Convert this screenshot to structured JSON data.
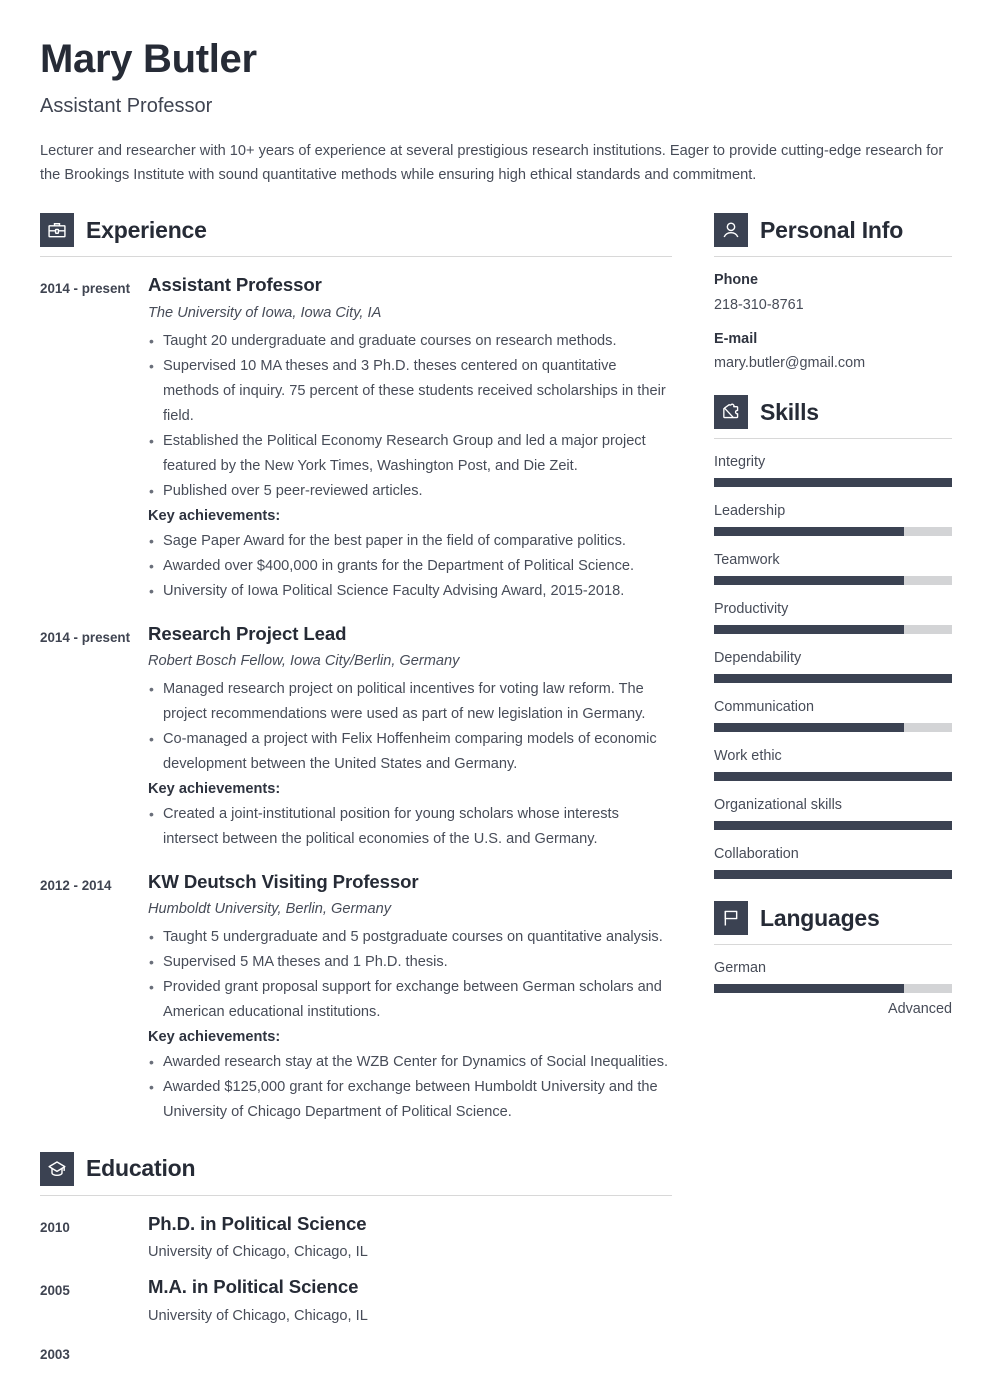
{
  "header": {
    "name": "Mary Butler",
    "job_title": "Assistant Professor",
    "summary": "Lecturer and researcher with 10+ years of experience at several prestigious research institutions. Eager to provide cutting-edge research for the Brookings Institute with sound quantitative methods while ensuring high ethical standards and commitment."
  },
  "colors": {
    "accent_dark": "#3b4252",
    "heading": "#262b36",
    "body_text": "#474c58",
    "bar_track": "#d3d4d6",
    "rule": "#d8d8d8"
  },
  "sections": {
    "experience": {
      "title": "Experience",
      "icon": "briefcase-icon",
      "entries": [
        {
          "date": "2014 - present",
          "title": "Assistant Professor",
          "subtitle": "The University of Iowa, Iowa City, IA",
          "bullets": [
            "Taught 20 undergraduate and graduate courses on research methods.",
            "Supervised 10 MA theses and 3 Ph.D. theses centered on quantitative methods of inquiry. 75 percent of these students received scholarships in their field.",
            "Established the Political Economy Research Group and led a major project featured by the New York Times, Washington Post, and Die Zeit.",
            "Published over 5 peer-reviewed articles."
          ],
          "achievements_label": "Key achievements:",
          "achievements": [
            "Sage Paper Award for the best paper in the field of comparative politics.",
            "Awarded over $400,000 in grants for the Department of Political Science.",
            "University of Iowa Political Science Faculty Advising Award, 2015-2018."
          ]
        },
        {
          "date": "2014 - present",
          "title": "Research Project Lead",
          "subtitle": "Robert Bosch Fellow, Iowa City/Berlin, Germany",
          "bullets": [
            "Managed research project on political incentives for voting law reform. The project recommendations were used as part of new legislation in Germany.",
            "Co-managed a project with Felix Hoffenheim comparing models of economic development between the United States and Germany."
          ],
          "achievements_label": "Key achievements:",
          "achievements": [
            "Created a joint-institutional position for young scholars whose interests intersect between the political economies of the U.S. and Germany."
          ]
        },
        {
          "date": "2012 - 2014",
          "title": "KW Deutsch Visiting Professor",
          "subtitle": "Humboldt University, Berlin, Germany",
          "bullets": [
            "Taught 5 undergraduate and 5 postgraduate courses on quantitative analysis.",
            "Supervised 5 MA theses and 1 Ph.D. thesis.",
            "Provided grant proposal support for exchange between German scholars and American educational institutions."
          ],
          "achievements_label": "Key achievements:",
          "achievements": [
            "Awarded research stay at the WZB Center for Dynamics of Social Inequalities.",
            "Awarded $125,000 grant for exchange between Humboldt University and the University of Chicago Department of Political Science."
          ]
        }
      ]
    },
    "education": {
      "title": "Education",
      "icon": "graduation-cap-icon",
      "entries": [
        {
          "date": "2010",
          "title": "Ph.D. in Political Science",
          "school": "University of Chicago, Chicago, IL"
        },
        {
          "date": "2005",
          "title": "M.A. in Political Science",
          "school": "University of Chicago, Chicago, IL"
        },
        {
          "date": "2003",
          "title": "",
          "school": ""
        }
      ]
    },
    "personal_info": {
      "title": "Personal Info",
      "icon": "person-icon",
      "fields": [
        {
          "label": "Phone",
          "value": "218-310-8761"
        },
        {
          "label": "E-mail",
          "value": "mary.butler@gmail.com"
        }
      ]
    },
    "skills": {
      "title": "Skills",
      "icon": "puzzle-piece-icon",
      "items": [
        {
          "name": "Integrity",
          "level": 100
        },
        {
          "name": "Leadership",
          "level": 80
        },
        {
          "name": "Teamwork",
          "level": 80
        },
        {
          "name": "Productivity",
          "level": 80
        },
        {
          "name": "Dependability",
          "level": 100
        },
        {
          "name": "Communication",
          "level": 80
        },
        {
          "name": "Work ethic",
          "level": 100
        },
        {
          "name": "Organizational skills",
          "level": 100
        },
        {
          "name": "Collaboration",
          "level": 100
        }
      ]
    },
    "languages": {
      "title": "Languages",
      "icon": "flag-icon",
      "items": [
        {
          "name": "German",
          "level": 80,
          "level_label": "Advanced"
        }
      ]
    }
  }
}
